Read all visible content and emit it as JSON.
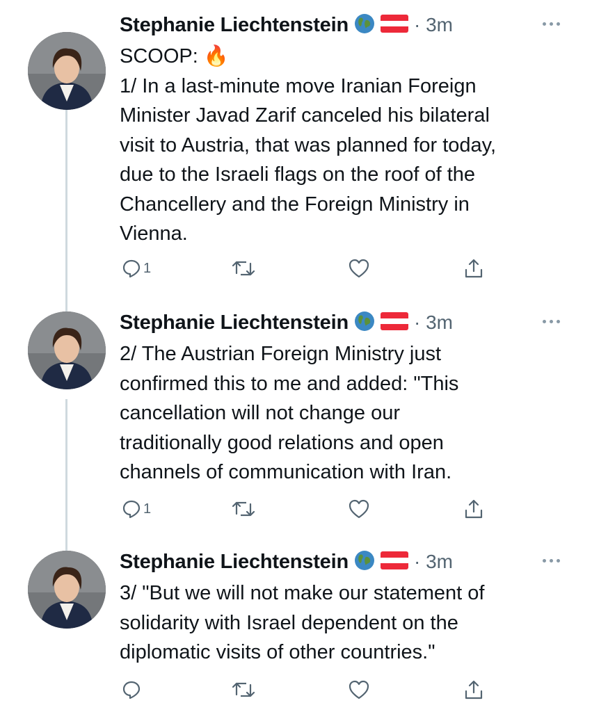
{
  "tweets": [
    {
      "author": "Stephanie Liechtenstein",
      "time": "· 3m",
      "text": "SCOOP: 🔥\n1/ In a last-minute move Iranian Foreign\nMinister Javad Zarif canceled his bilateral\nvisit to Austria, that was planned for today,\ndue to the Israeli flags on the roof of the\nChancellery and the Foreign Ministry in\nVienna.",
      "replies": "1"
    },
    {
      "author": "Stephanie Liechtenstein",
      "time": "· 3m",
      "text": "2/ The Austrian Foreign Ministry just\nconfirmed this to me and added: \"This\ncancellation will not change our\ntraditionally good relations and open\nchannels of communication with Iran.",
      "replies": "1"
    },
    {
      "author": "Stephanie Liechtenstein",
      "time": "· 3m",
      "text": "3/ \"But we will not make our statement of\nsolidarity with Israel dependent on the\ndiplomatic visits of other countries.\"",
      "replies": ""
    }
  ],
  "badges": [
    "globe-emoji",
    "austria-flag"
  ],
  "colors": {
    "text": "#0f1419",
    "secondary": "#536471",
    "thread_line": "#cfd9de",
    "flag_red": "#ed2939"
  }
}
